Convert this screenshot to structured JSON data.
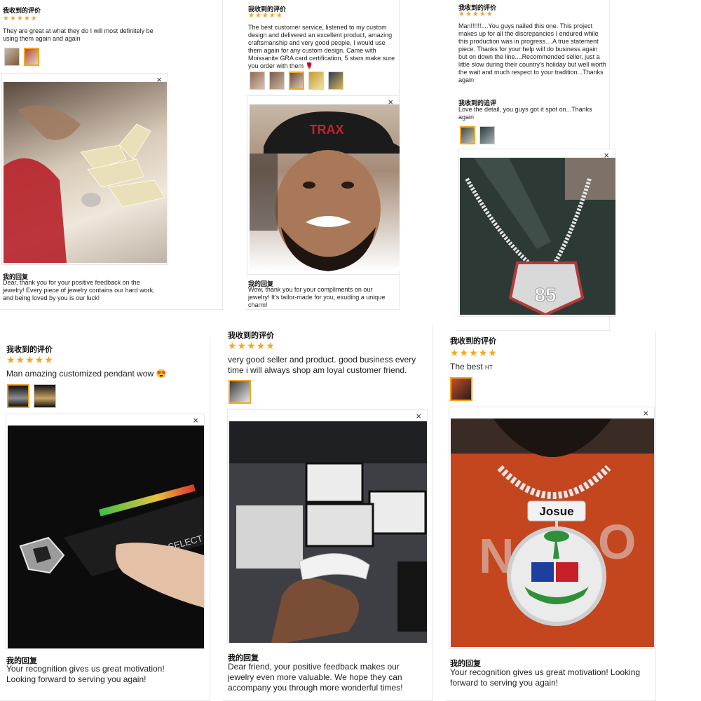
{
  "colors": {
    "star": "#f5a623",
    "border": "#e6e6e6",
    "text": "#222222"
  },
  "icons": {
    "close": "close-icon",
    "star": "star-icon"
  },
  "reviews": [
    {
      "heading": "我收到的评价",
      "stars": "★★★★★",
      "text": "They are great at what they do I will most definitely be using them again and again",
      "reply_heading": "我的回复",
      "reply": "Dear, thank you for your positive feedback on the jewelry! Every piece of jewelry contains our hard work, and being loved by you is our luck!",
      "close": "×"
    },
    {
      "heading": "我收到的评价",
      "stars": "★★★★★",
      "text": "The best customer service, listened to my custom design and delivered an excellent product, amazing craftsmanship and very good people, I would use them again for any custom design. Came with Moissanite GRA card certification, 5 stars make sure you order with them 🌹",
      "reply_heading": "我的回复",
      "reply": "Wow, thank you for your compliments on our jewelry! It's tailor-made for you, exuding a unique charm!",
      "close": "×"
    },
    {
      "heading": "我收到的评价",
      "stars": "★★★★★",
      "text": "Man!!!!!!....You guys nailed this one. This project makes up for all the discrepancies I endured while this production was in progress....A true statement piece. Thanks for your help will do business again but on down the line....Recommended seller, just a little slow during their country's holiday but well worth the wait and much respect to your tradition...Thanks again",
      "followup_heading": "我收到的追评",
      "followup": "Love the detail, you guys got it spot on...Thanks again",
      "close": "×"
    },
    {
      "heading": "我收到的评价",
      "stars": "★★★★★",
      "text": "Man amazing customized pendant wow 😍",
      "reply_heading": "我的回复",
      "reply": "Your recognition gives us great motivation! Looking forward to serving you again!",
      "close": "×"
    },
    {
      "heading": "我收到的评价",
      "stars": "★★★★★",
      "text": "very good seller and product. good business every time i will always shop am loyal customer friend.",
      "reply_heading": "我的回复",
      "reply": "Dear friend, your positive feedback makes our jewelry even more valuable. We hope they can accompany you through more wonderful times!",
      "close": "×"
    },
    {
      "heading": "我收到的评价",
      "stars": "★★★★★",
      "text": "The best",
      "text_suffix": "HT",
      "reply_heading": "我的回复",
      "reply": "Your recognition gives us great motivation! Looking forward to serving you again!",
      "close": "×"
    }
  ],
  "photo_text": {
    "cap_text": "TRAX",
    "sign_text": "85",
    "name_plate": "Josue",
    "tester_label": "SELECT"
  }
}
